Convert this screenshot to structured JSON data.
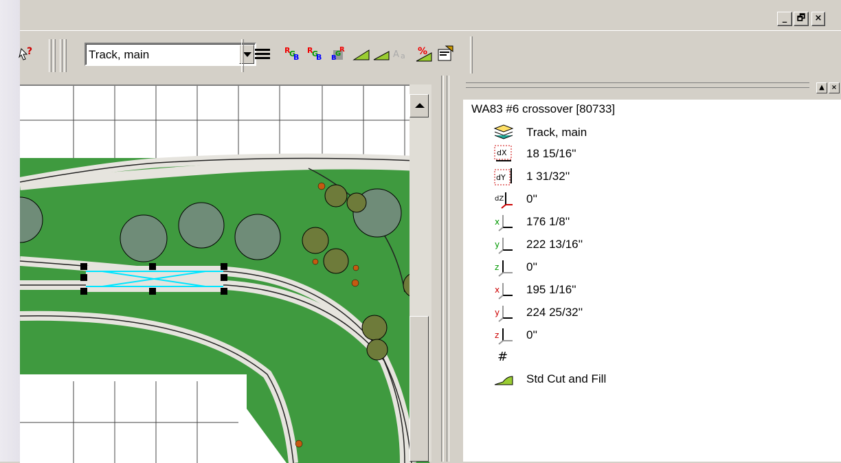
{
  "window": {
    "buttons": [
      "_",
      "🗗",
      "×"
    ]
  },
  "toolbar": {
    "layer_value": "Track, main",
    "icons": [
      "question-pointer-icon",
      "lines-icon",
      "rgb-1-icon",
      "rgb-2-icon",
      "rgb-pattern-icon",
      "cut-fill-icon",
      "grade-icon",
      "font-icon",
      "percent-grade-icon",
      "properties-icon"
    ]
  },
  "properties": {
    "title": "WA83 #6 crossover [80733]",
    "rows": [
      {
        "icon": "layers-icon",
        "text": "Track, main"
      },
      {
        "icon": "dx-icon",
        "text": "18 15/16''"
      },
      {
        "icon": "dy-icon",
        "text": "1 31/32''"
      },
      {
        "icon": "dz-icon",
        "text": "0''"
      },
      {
        "icon": "x1-icon",
        "text": "176 1/8''"
      },
      {
        "icon": "y1-icon",
        "text": "222 13/16''"
      },
      {
        "icon": "z1-icon",
        "text": "0''"
      },
      {
        "icon": "x2-icon",
        "text": "195 1/16''"
      },
      {
        "icon": "y2-icon",
        "text": "224 25/32''"
      },
      {
        "icon": "z2-icon",
        "text": "0''"
      },
      {
        "icon": "hash-icon",
        "text": ""
      },
      {
        "icon": "cut-fill-icon",
        "text": "Std Cut and Fill"
      }
    ],
    "panel_buttons": [
      "▲",
      "×"
    ]
  },
  "colors": {
    "grass": "#3f9a3f",
    "ballast": "#e6e4de",
    "tree_gray": "#6f8c78",
    "tree_brown": "#6e7b3a",
    "crossover_highlight": "#00e5ff"
  }
}
